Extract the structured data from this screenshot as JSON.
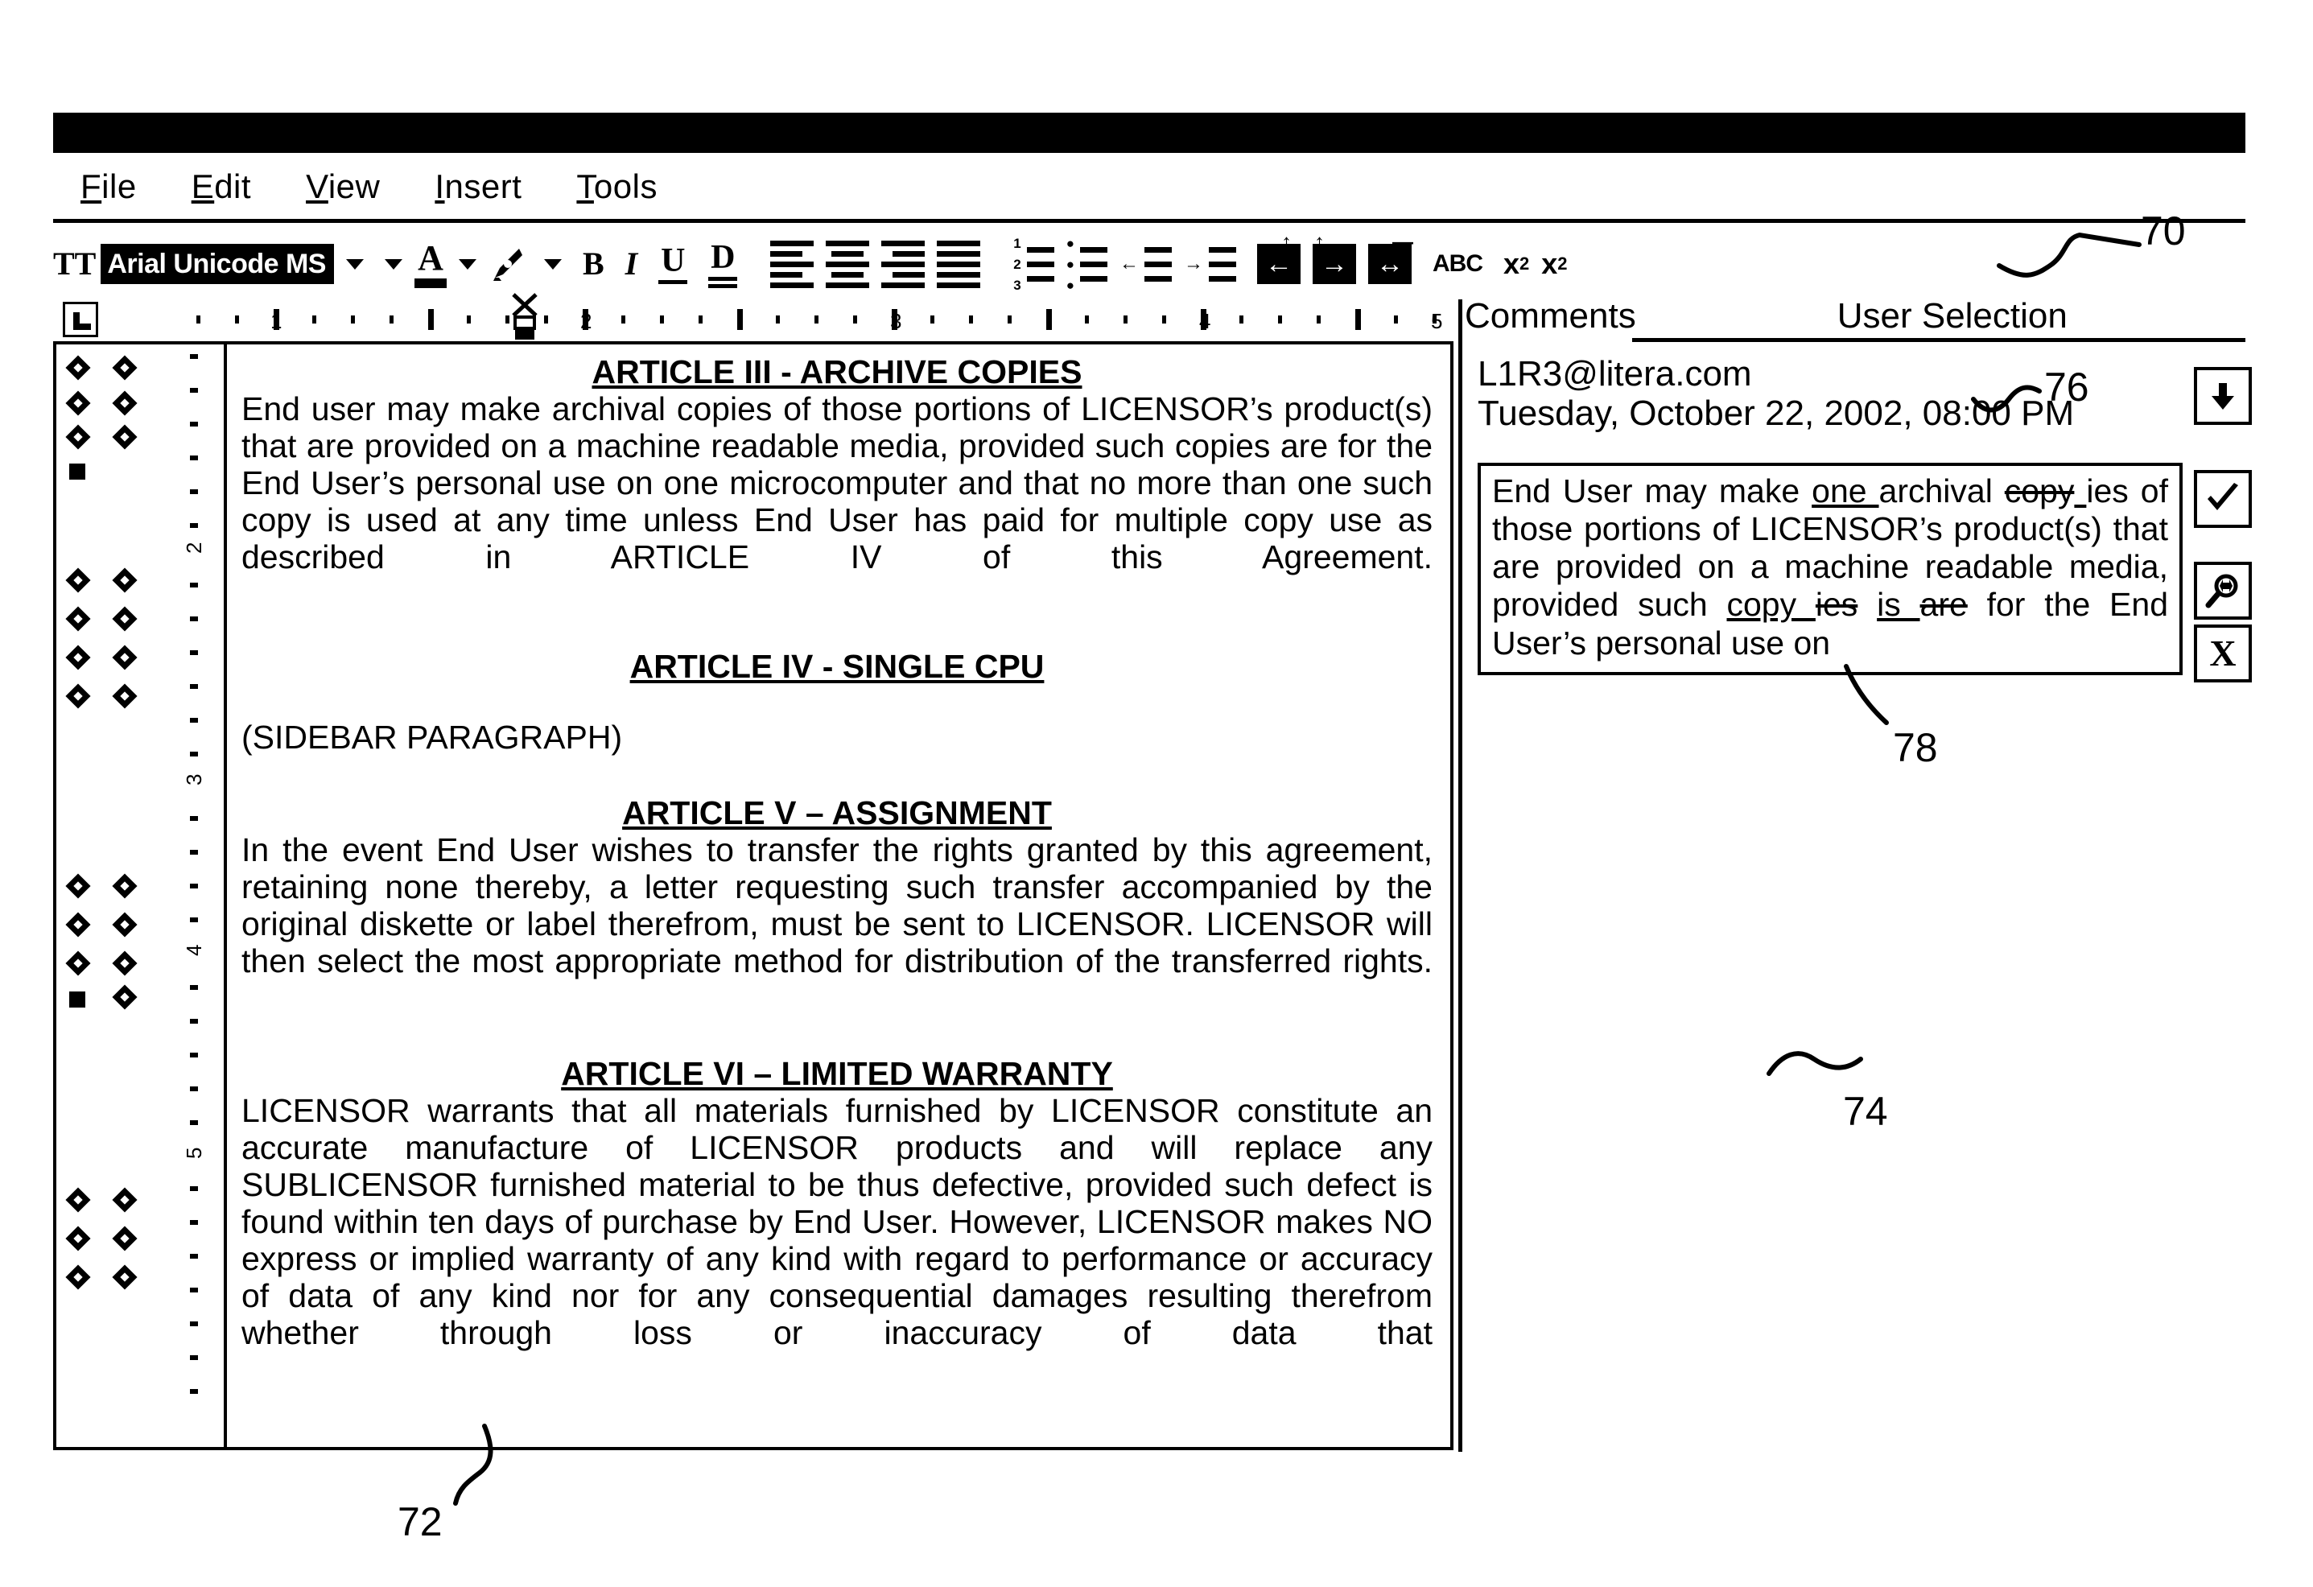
{
  "window": {
    "titlebar_label": ""
  },
  "menubar": {
    "items": [
      {
        "label": "File",
        "mnemonic": "F",
        "rest": "ile"
      },
      {
        "label": "Edit",
        "mnemonic": "E",
        "rest": "dit"
      },
      {
        "label": "View",
        "mnemonic": "V",
        "rest": "iew"
      },
      {
        "label": "Insert",
        "mnemonic": "I",
        "rest": "nsert"
      },
      {
        "label": "Tools",
        "mnemonic": "T",
        "rest": "ools"
      }
    ]
  },
  "toolbar": {
    "font_name_value": "Arial Unicode MS",
    "font_name_prefix_icon": "TT",
    "icons": [
      {
        "name": "font-color-icon",
        "glyph": "A"
      },
      {
        "name": "highlight-icon",
        "glyph": "✎"
      },
      {
        "name": "bold-icon",
        "glyph": "B"
      },
      {
        "name": "italic-icon",
        "glyph": "I"
      },
      {
        "name": "underline-icon",
        "glyph": "U"
      },
      {
        "name": "double-underline-icon",
        "glyph": "D"
      },
      {
        "name": "align-left-icon",
        "glyph": ""
      },
      {
        "name": "align-center-icon",
        "glyph": ""
      },
      {
        "name": "align-right-icon",
        "glyph": ""
      },
      {
        "name": "align-justify-icon",
        "glyph": ""
      },
      {
        "name": "numbered-list-icon",
        "glyph": ""
      },
      {
        "name": "bulleted-list-icon",
        "glyph": ""
      },
      {
        "name": "decrease-indent-icon",
        "glyph": ""
      },
      {
        "name": "increase-indent-icon",
        "glyph": ""
      },
      {
        "name": "indent-left-icon",
        "glyph": "←"
      },
      {
        "name": "indent-right-icon",
        "glyph": "→"
      },
      {
        "name": "indent-both-icon",
        "glyph": "↔"
      },
      {
        "name": "spelling-abc-icon",
        "glyph": "ABC"
      },
      {
        "name": "superscript-icon",
        "glyph": "x2"
      },
      {
        "name": "subscript-icon",
        "glyph": "x2"
      }
    ]
  },
  "ruler": {
    "numbers": [
      "1",
      "2",
      "3",
      "4",
      "5"
    ],
    "tab_stop_button": "L"
  },
  "vertical_ruler": {
    "numbers": [
      "2",
      "3",
      "4",
      "5"
    ]
  },
  "document": {
    "blocks": [
      {
        "type": "heading",
        "name": "heading-article-3",
        "text": "ARTICLE III - ARCHIVE COPIES"
      },
      {
        "type": "paragraph",
        "name": "paragraph-article-3",
        "text": "End user may make archival copies of those portions of LICENSOR’s product(s) that are provided on a machine readable media, provided such copies are for the End User’s personal use on one microcomputer and that no more than one such copy is used at any time unless End User has paid for multiple copy use as described in ARTICLE IV of this Agreement."
      },
      {
        "type": "heading",
        "name": "heading-article-4",
        "text": "ARTICLE IV - SINGLE CPU"
      },
      {
        "type": "paragraph",
        "name": "paragraph-article-4",
        "text": "(SIDEBAR PARAGRAPH)"
      },
      {
        "type": "heading",
        "name": "heading-article-5",
        "text": "ARTICLE V – ASSIGNMENT"
      },
      {
        "type": "paragraph",
        "name": "paragraph-article-5",
        "text": "In the event End User wishes to transfer the rights granted by this agreement, retaining none thereby, a letter requesting such transfer accompanied by the original diskette or label therefrom, must be sent to LICENSOR. LICENSOR will then select the most appropriate method for distribution of the transferred rights."
      },
      {
        "type": "heading",
        "name": "heading-article-6",
        "text": "ARTICLE VI – LIMITED WARRANTY"
      },
      {
        "type": "paragraph",
        "name": "paragraph-article-6",
        "text": "LICENSOR warrants that all materials furnished by LICENSOR constitute an accurate manufacture of LICENSOR products and will replace any SUBLICENSOR furnished material to be thus defective, provided such defect is found within ten days of purchase by End User. However, LICENSOR makes NO express or implied warranty of any kind with regard to performance or accuracy of data of any kind nor for any consequential damages resulting therefrom whether through loss or inaccuracy of data that"
      }
    ]
  },
  "comments_pane": {
    "header_comments": "Comments",
    "header_user_selection": "User Selection",
    "author": "L1R3@litera.com",
    "timestamp": "Tuesday, October 22, 2002, 08:00 PM",
    "comment_runs": [
      {
        "text": "End User may make ",
        "style": "normal"
      },
      {
        "text": "one ",
        "style": "inserted"
      },
      {
        "text": "archival ",
        "style": "normal"
      },
      {
        "text": "copy",
        "style": "deleted"
      },
      {
        "text": " ",
        "style": "normal"
      },
      {
        "text": "ies",
        "style": "normal"
      },
      {
        "text": " of those portions of LICENSOR’s product(s) that are provided on a machine readable media, provided such ",
        "style": "normal"
      },
      {
        "text": "copy ",
        "style": "inserted"
      },
      {
        "text": "ies",
        "style": "deleted"
      },
      {
        "text": " ",
        "style": "normal"
      },
      {
        "text": "is ",
        "style": "inserted"
      },
      {
        "text": "are",
        "style": "deleted"
      },
      {
        "text": " for the End User’s personal use on",
        "style": "normal"
      }
    ],
    "buttons": [
      {
        "name": "move-down-button",
        "glyph": "⬇",
        "label": "down-arrow"
      },
      {
        "name": "accept-button",
        "glyph": "✔",
        "label": "checkmark"
      },
      {
        "name": "zoom-in-button",
        "glyph": "🔍",
        "label": "magnifier-plus"
      },
      {
        "name": "reject-button",
        "glyph": "X",
        "label": "x-mark"
      }
    ]
  },
  "reference_numerals": {
    "toolbar": "70",
    "document": "72",
    "comments_pane": "74",
    "comment_header": "76",
    "comment_box": "78"
  }
}
